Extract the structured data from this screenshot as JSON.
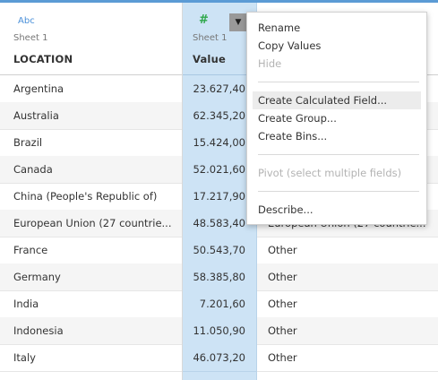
{
  "columns": {
    "location": {
      "type_icon": "Abc",
      "source": "Sheet 1",
      "name": "LOCATION"
    },
    "value": {
      "type_icon": "#",
      "source": "Sheet 1",
      "name": "Value",
      "dropdown_icon": "▼"
    }
  },
  "rows": [
    {
      "location": "Argentina",
      "value": "23.627,40",
      "category": ""
    },
    {
      "location": "Australia",
      "value": "62.345,20",
      "category": ""
    },
    {
      "location": "Brazil",
      "value": "15.424,00",
      "category": ""
    },
    {
      "location": "Canada",
      "value": "52.021,60",
      "category": ""
    },
    {
      "location": "China (People's Republic of)",
      "value": "17.217,90",
      "category": ""
    },
    {
      "location": "European Union (27 countrie...",
      "value": "48.583,40",
      "category": "European Union (27 countrie..."
    },
    {
      "location": "France",
      "value": "50.543,70",
      "category": "Other"
    },
    {
      "location": "Germany",
      "value": "58.385,80",
      "category": "Other"
    },
    {
      "location": "India",
      "value": "7.201,60",
      "category": "Other"
    },
    {
      "location": "Indonesia",
      "value": "11.050,90",
      "category": "Other"
    },
    {
      "location": "Italy",
      "value": "46.073,20",
      "category": "Other"
    }
  ],
  "context_menu": {
    "items": [
      {
        "label": "Rename",
        "enabled": true
      },
      {
        "label": "Copy Values",
        "enabled": true
      },
      {
        "label": "Hide",
        "enabled": false
      },
      {
        "label": "Create Calculated Field...",
        "enabled": true,
        "highlighted": true
      },
      {
        "label": "Create Group...",
        "enabled": true
      },
      {
        "label": "Create Bins...",
        "enabled": true
      },
      {
        "label": "Pivot (select multiple fields)",
        "enabled": false
      },
      {
        "label": "Describe...",
        "enabled": true
      }
    ]
  },
  "colors": {
    "accent": "#5b9bd5",
    "selected_column": "#cde3f5",
    "measure_icon": "#2ea84a",
    "dimension_icon": "#4a90d9"
  }
}
